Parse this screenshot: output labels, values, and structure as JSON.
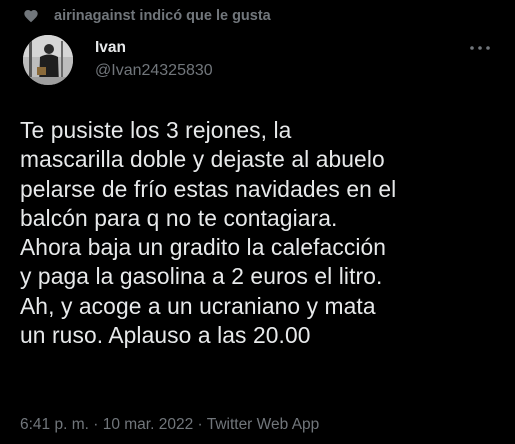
{
  "social_context": {
    "icon": "heart-icon",
    "text": "airinagainst indicó que le gusta"
  },
  "author": {
    "display_name": "Ivan",
    "handle": "@Ivan24325830",
    "avatar": "avatar-photo"
  },
  "more_icon": "more-dots-icon",
  "tweet": {
    "lines": [
      "Te pusiste los 3 rejones, la",
      "mascarilla doble y dejaste al abuelo",
      "pelarse de frío estas navidades en el",
      "balcón para q no te contagiara.",
      "Ahora baja un gradito la calefacción",
      "y paga la gasolina a 2 euros el litro.",
      "Ah, y acoge a un ucraniano y mata",
      "un ruso. Aplauso a las 20.00"
    ]
  },
  "meta": {
    "time": "6:41 p. m.",
    "separator": " · ",
    "date": "10 mar. 2022",
    "source": "Twitter Web App"
  },
  "colors": {
    "background": "#000000",
    "text": "#e7e9ea",
    "secondary": "#71767b"
  }
}
